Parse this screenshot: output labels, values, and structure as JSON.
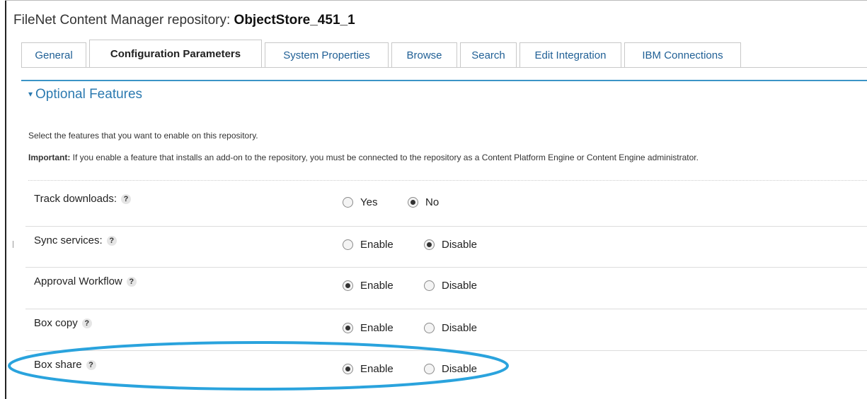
{
  "title": {
    "prefix": "FileNet Content Manager repository: ",
    "repository": "ObjectStore_451_1"
  },
  "tabs": [
    {
      "label": "General"
    },
    {
      "label": "Configuration Parameters",
      "active": true
    },
    {
      "label": "System Properties"
    },
    {
      "label": "Browse"
    },
    {
      "label": "Search"
    },
    {
      "label": "Edit Integration"
    },
    {
      "label": "IBM Connections"
    }
  ],
  "section": {
    "caret": "▾",
    "title": "Optional Features"
  },
  "description": "Select the features that you want to enable on this repository.",
  "important": {
    "label": "Important:",
    "text": " If you enable a feature that installs an add-on to the repository, you must be connected to the repository as a Content Platform Engine or Content Engine administrator."
  },
  "help_glyph": "?",
  "features": [
    {
      "label": "Track downloads:",
      "option1": "Yes",
      "option2": "No",
      "selected": "option2"
    },
    {
      "label": "Sync services:",
      "option1": "Enable",
      "option2": "Disable",
      "selected": "option2"
    },
    {
      "label": "Approval Workflow",
      "option1": "Enable",
      "option2": "Disable",
      "selected": "option1"
    },
    {
      "label": "Box copy",
      "option1": "Enable",
      "option2": "Disable",
      "selected": "option1"
    },
    {
      "label": "Box share",
      "option1": "Enable",
      "option2": "Disable",
      "selected": "option1",
      "highlighted": true
    }
  ],
  "colors": {
    "accent": "#3b94c7",
    "highlight_ellipse": "#2aa3dd",
    "link": "#1f5f95"
  }
}
